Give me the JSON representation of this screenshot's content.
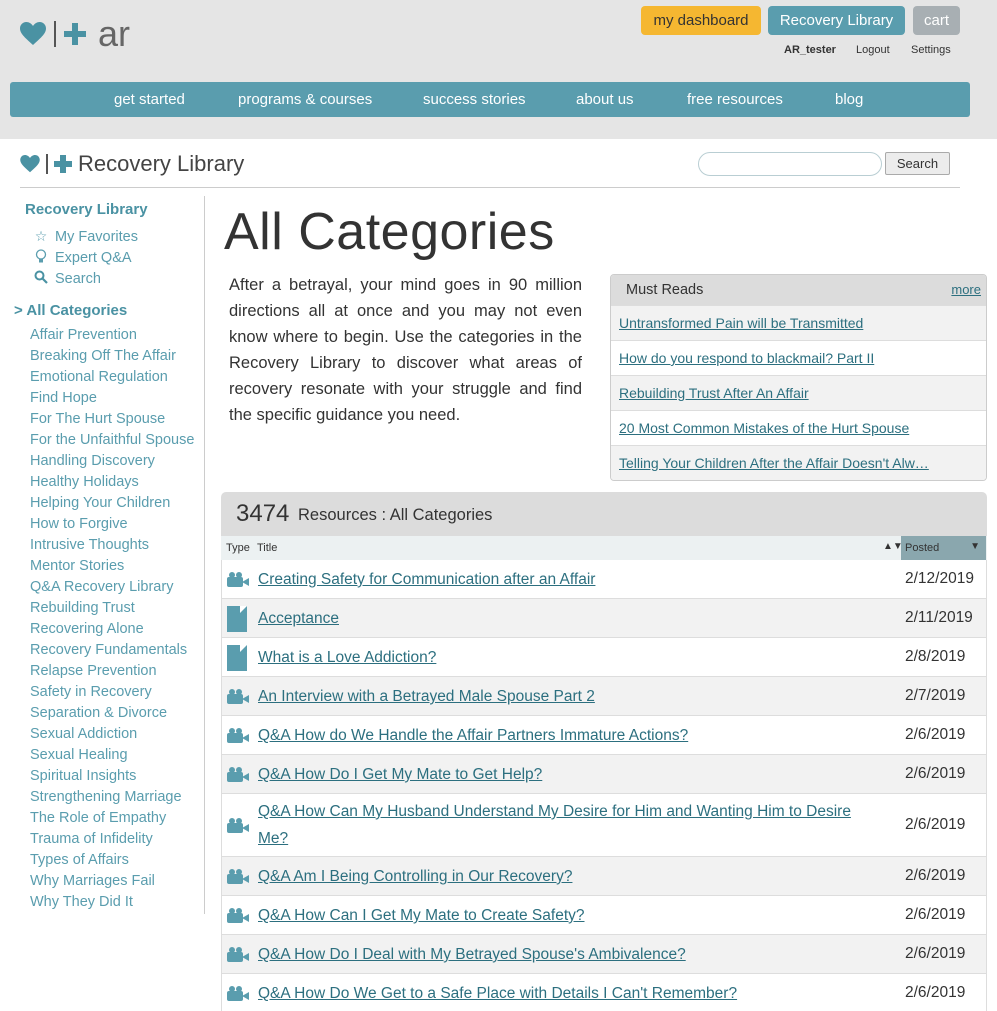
{
  "header": {
    "logo_text": "ar",
    "buttons": {
      "dashboard": "my dashboard",
      "library": "Recovery Library",
      "cart": "cart"
    },
    "user": {
      "name": "AR_tester",
      "logout": "Logout",
      "settings": "Settings"
    },
    "nav": [
      "get started",
      "programs & courses",
      "success stories",
      "about us",
      "free resources",
      "blog"
    ]
  },
  "library": {
    "title": "Recovery Library",
    "search_button": "Search",
    "search_placeholder": ""
  },
  "sidebar": {
    "heading": "Recovery Library",
    "links": [
      {
        "icon": "star-icon",
        "label": "My Favorites"
      },
      {
        "icon": "lightbulb-icon",
        "label": "Expert Q&A"
      },
      {
        "icon": "search-icon",
        "label": "Search"
      }
    ],
    "all_categories": "> All Categories",
    "categories": [
      "Affair Prevention",
      "Breaking Off The Affair",
      "Emotional Regulation",
      "Find Hope",
      "For The Hurt Spouse",
      "For the Unfaithful Spouse",
      "Handling Discovery",
      "Healthy Holidays",
      "Helping Your Children",
      "How to Forgive",
      "Intrusive Thoughts",
      "Mentor Stories",
      "Q&A Recovery Library",
      "Rebuilding Trust",
      "Recovering Alone",
      "Recovery Fundamentals",
      "Relapse Prevention",
      "Safety in Recovery",
      "Separation & Divorce",
      "Sexual Addiction",
      "Sexual Healing",
      "Spiritual Insights",
      "Strengthening Marriage",
      "The Role of Empathy",
      "Trauma of Infidelity",
      "Types of Affairs",
      "Why Marriages Fail",
      "Why They Did It"
    ]
  },
  "main": {
    "heading": "All Categories",
    "intro": "After a betrayal, your mind goes in 90 million directions all at once and you may not even know where to begin. Use the categories in the Recovery Library to discover what areas of recovery resonate with your struggle and find the specific guidance you need."
  },
  "must_reads": {
    "title": "Must Reads",
    "more": "more",
    "items": [
      "Untransformed Pain will be Transmitted",
      "How do you respond to blackmail? Part II",
      "Rebuilding Trust After An Affair",
      "20 Most Common Mistakes of the Hurt Spouse",
      "Telling Your Children After the Affair Doesn't Alw…"
    ]
  },
  "resources": {
    "count": "3474",
    "label": "Resources : All Categories",
    "col_type": "Type",
    "col_title": "Title",
    "col_posted": "Posted",
    "rows": [
      {
        "type": "video-icon",
        "title": "Creating Safety for Communication after an Affair",
        "date": "2/12/2019"
      },
      {
        "type": "document-icon",
        "title": "Acceptance",
        "date": "2/11/2019"
      },
      {
        "type": "document-icon",
        "title": "What is a Love Addiction?",
        "date": "2/8/2019"
      },
      {
        "type": "video-icon",
        "title": "An Interview with a Betrayed Male Spouse Part 2",
        "date": "2/7/2019"
      },
      {
        "type": "video-icon",
        "title": "Q&A How do We Handle the Affair Partners Immature Actions?",
        "date": "2/6/2019"
      },
      {
        "type": "video-icon",
        "title": "Q&A How Do I Get My Mate to Get Help?",
        "date": "2/6/2019"
      },
      {
        "type": "video-icon",
        "title": "Q&A How Can My Husband Understand My Desire for Him and Wanting Him to Desire Me?",
        "date": "2/6/2019"
      },
      {
        "type": "video-icon",
        "title": "Q&A Am I Being Controlling in Our Recovery?",
        "date": "2/6/2019"
      },
      {
        "type": "video-icon",
        "title": "Q&A How Can I Get My Mate to Create Safety?",
        "date": "2/6/2019"
      },
      {
        "type": "video-icon",
        "title": "Q&A How Do I Deal with My Betrayed Spouse's Ambivalence?",
        "date": "2/6/2019"
      },
      {
        "type": "video-icon",
        "title": "Q&A How Do We Get to a Safe Place with Details I Can't Remember?",
        "date": "2/6/2019"
      }
    ]
  }
}
